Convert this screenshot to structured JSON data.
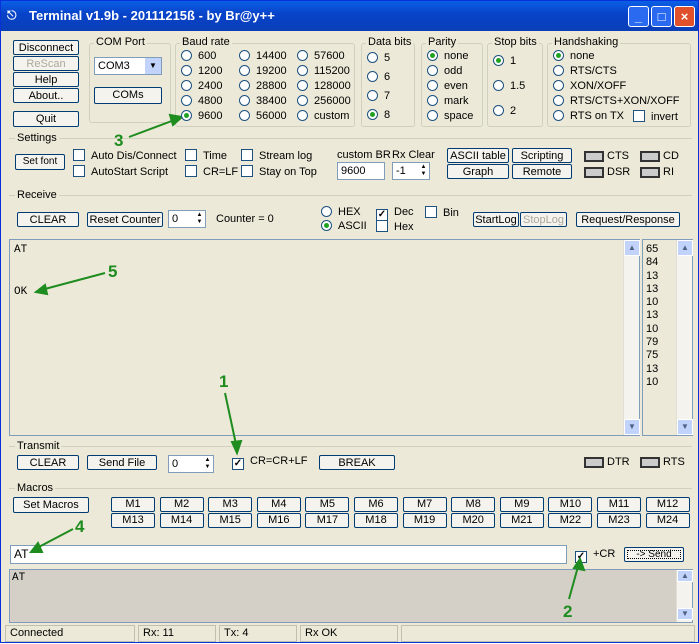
{
  "title": "Terminal v1.9b - 20111215ß - by Br@y++",
  "conn": {
    "disconnect": "Disconnect",
    "rescan": "ReScan",
    "help": "Help",
    "about": "About..",
    "quit": "Quit"
  },
  "comport": {
    "label": "COM Port",
    "value": "COM3",
    "coms": "COMs"
  },
  "baud": {
    "label": "Baud rate",
    "options": [
      "600",
      "1200",
      "2400",
      "4800",
      "9600",
      "14400",
      "19200",
      "28800",
      "38400",
      "56000",
      "57600",
      "115200",
      "128000",
      "256000",
      "custom"
    ],
    "selected": "9600"
  },
  "databits": {
    "label": "Data bits",
    "options": [
      "5",
      "6",
      "7",
      "8"
    ],
    "selected": "8"
  },
  "parity": {
    "label": "Parity",
    "options": [
      "none",
      "odd",
      "even",
      "mark",
      "space"
    ],
    "selected": "none"
  },
  "stopbits": {
    "label": "Stop bits",
    "options": [
      "1",
      "1.5",
      "2"
    ],
    "selected": "1"
  },
  "handshaking": {
    "label": "Handshaking",
    "options": [
      "none",
      "RTS/CTS",
      "XON/XOFF",
      "RTS/CTS+XON/XOFF",
      "RTS on TX"
    ],
    "selected": "none",
    "invert": "invert"
  },
  "settings": {
    "label": "Settings",
    "setfont": "Set font",
    "auto_dis": "Auto Dis/Connect",
    "autostart": "AutoStart Script",
    "time": "Time",
    "crlf": "CR=LF",
    "streamlog": "Stream log",
    "stayontop": "Stay on Top",
    "custombr_label": "custom BR",
    "custombr_value": "9600",
    "rxclear_label": "Rx Clear",
    "rxclear_value": "-1",
    "ascii_table": "ASCII table",
    "graph": "Graph",
    "scripting": "Scripting",
    "remote": "Remote",
    "cts": "CTS",
    "cd": "CD",
    "dsr": "DSR",
    "ri": "RI"
  },
  "receive": {
    "label": "Receive",
    "clear": "CLEAR",
    "reset_counter": "Reset Counter",
    "counter_value": "0",
    "counter_label": "Counter =  0",
    "hex": "HEX",
    "ascii": "ASCII",
    "dec": "Dec",
    "hex2": "Hex",
    "bin": "Bin",
    "startlog": "StartLog",
    "stoplog": "StopLog",
    "reqresp": "Request/Response",
    "line1": "AT",
    "line2": "OK",
    "dec_values": [
      "65",
      "84",
      "13",
      "13",
      "10",
      "13",
      "10",
      "79",
      "75",
      "13",
      "10"
    ]
  },
  "transmit": {
    "label": "Transmit",
    "clear": "CLEAR",
    "sendfile": "Send File",
    "counter": "0",
    "crcrlf": "CR=CR+LF",
    "break": "BREAK",
    "dtr": "DTR",
    "rts": "RTS"
  },
  "macros": {
    "label": "Macros",
    "set": "Set Macros",
    "row1": [
      "M1",
      "M2",
      "M3",
      "M4",
      "M5",
      "M6",
      "M7",
      "M8",
      "M9",
      "M10",
      "M11",
      "M12"
    ],
    "row2": [
      "M13",
      "M14",
      "M15",
      "M16",
      "M17",
      "M18",
      "M19",
      "M20",
      "M21",
      "M22",
      "M23",
      "M24"
    ]
  },
  "send": {
    "input": "AT",
    "cr": "+CR",
    "button": "-> Send",
    "log": "AT"
  },
  "status": {
    "connected": "Connected",
    "rx": "Rx: 11",
    "tx": "Tx: 4",
    "rxok": "Rx OK"
  },
  "annotations": [
    "1",
    "2",
    "3",
    "4",
    "5"
  ],
  "colors": {
    "annotation": "#1e8c1e",
    "titlebar": "#0842c8"
  }
}
